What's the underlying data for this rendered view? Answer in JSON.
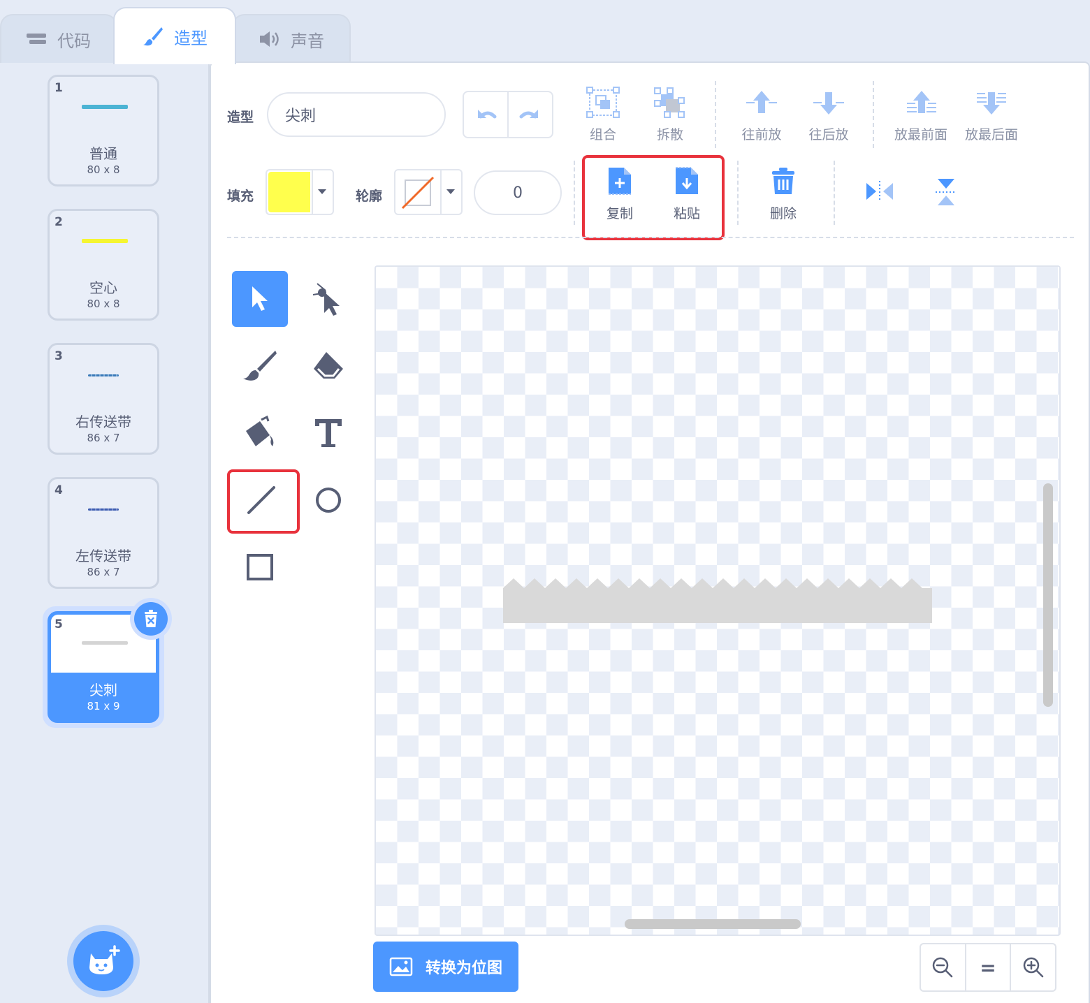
{
  "tabs": [
    {
      "label": "代码",
      "icon": "code-icon"
    },
    {
      "label": "造型",
      "icon": "brush-icon"
    },
    {
      "label": "声音",
      "icon": "speaker-icon"
    }
  ],
  "costumes": [
    {
      "index": "1",
      "name": "普通",
      "size": "80 x 8",
      "color": "#4cb3d4"
    },
    {
      "index": "2",
      "name": "空心",
      "size": "80 x 8",
      "color": "#f5f532"
    },
    {
      "index": "3",
      "name": "右传送带",
      "size": "86 x 7",
      "color": "#3a7ab8"
    },
    {
      "index": "4",
      "name": "左传送带",
      "size": "86 x 7",
      "color": "#3b5bb0"
    },
    {
      "index": "5",
      "name": "尖刺",
      "size": "81 x 9",
      "color": "#d0d0d0",
      "selected": true
    }
  ],
  "editor": {
    "costume_label": "造型",
    "costume_name": "尖刺",
    "fill_label": "填充",
    "fill_color": "#ffff4d",
    "outline_label": "轮廓",
    "outline_width": "0",
    "group": "组合",
    "ungroup": "拆散",
    "forward": "往前放",
    "backward": "往后放",
    "front": "放最前面",
    "back": "放最后面",
    "copy": "复制",
    "paste": "粘贴",
    "delete": "删除",
    "convert_button": "转换为位图",
    "zoom_reset": "="
  },
  "colors": {
    "accent": "#4c97ff",
    "highlight": "#e8323c",
    "text": "#575e75"
  }
}
